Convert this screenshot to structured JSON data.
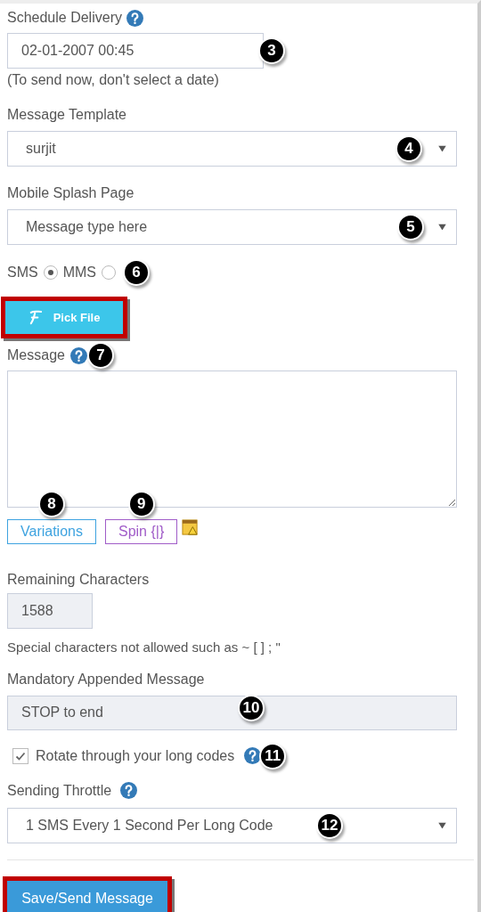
{
  "schedule_delivery": {
    "label": "Schedule Delivery",
    "value": "02-01-2007 00:45",
    "callout": "3",
    "hint": "(To send now, don't select a date)"
  },
  "message_template": {
    "label": "Message Template",
    "value": "surjit",
    "callout": "4"
  },
  "mobile_splash_page": {
    "label": "Mobile Splash Page",
    "placeholder": "Message type here",
    "callout": "5"
  },
  "message_type": {
    "options": [
      {
        "label": "SMS",
        "selected": true
      },
      {
        "label": "MMS",
        "selected": false
      }
    ],
    "callout": "6"
  },
  "pick_file": {
    "label": "Pick File",
    "highlighted": true
  },
  "message": {
    "label": "Message",
    "callout": "7"
  },
  "message_tools": [
    {
      "label": "Variations",
      "color": "#3ea3e0",
      "callout": "8"
    },
    {
      "label": "Spin {|}",
      "color": "#a05cc8",
      "callout": "9"
    }
  ],
  "remaining_characters": {
    "label": "Remaining Characters",
    "value": "1588"
  },
  "special_characters_note": "Special characters not allowed such as ~ [ ] ; \"",
  "mandatory_appended_message": {
    "label": "Mandatory Appended Message",
    "value": "STOP to end",
    "callout": "10"
  },
  "rotate_long_codes": {
    "label": "Rotate through your long codes",
    "checked": true,
    "callout": "11"
  },
  "sending_throttle": {
    "label": "Sending Throttle",
    "value": "1 SMS Every 1 Second Per Long Code",
    "callout": "12"
  },
  "save_button": {
    "label": "Save/Send Message",
    "highlighted": true
  }
}
